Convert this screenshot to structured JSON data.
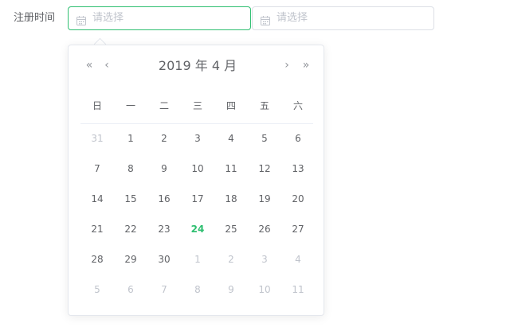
{
  "form": {
    "label": "注册时间",
    "start_placeholder": "请选择",
    "end_placeholder": "请选择"
  },
  "picker": {
    "year": "2019",
    "year_suffix": " 年 ",
    "month": "4",
    "month_suffix": " 月",
    "prev_year_glyph": "«",
    "prev_month_glyph": "‹",
    "next_month_glyph": "›",
    "next_year_glyph": "»",
    "weekdays": [
      "日",
      "一",
      "二",
      "三",
      "四",
      "五",
      "六"
    ],
    "weeks": [
      [
        {
          "d": "31",
          "t": "prev"
        },
        {
          "d": "1",
          "t": "cur"
        },
        {
          "d": "2",
          "t": "cur"
        },
        {
          "d": "3",
          "t": "cur"
        },
        {
          "d": "4",
          "t": "cur"
        },
        {
          "d": "5",
          "t": "cur"
        },
        {
          "d": "6",
          "t": "cur"
        }
      ],
      [
        {
          "d": "7",
          "t": "cur"
        },
        {
          "d": "8",
          "t": "cur"
        },
        {
          "d": "9",
          "t": "cur"
        },
        {
          "d": "10",
          "t": "cur"
        },
        {
          "d": "11",
          "t": "cur"
        },
        {
          "d": "12",
          "t": "cur"
        },
        {
          "d": "13",
          "t": "cur"
        }
      ],
      [
        {
          "d": "14",
          "t": "cur"
        },
        {
          "d": "15",
          "t": "cur"
        },
        {
          "d": "16",
          "t": "cur"
        },
        {
          "d": "17",
          "t": "cur"
        },
        {
          "d": "18",
          "t": "cur"
        },
        {
          "d": "19",
          "t": "cur"
        },
        {
          "d": "20",
          "t": "cur"
        }
      ],
      [
        {
          "d": "21",
          "t": "cur"
        },
        {
          "d": "22",
          "t": "cur"
        },
        {
          "d": "23",
          "t": "cur"
        },
        {
          "d": "24",
          "t": "today"
        },
        {
          "d": "25",
          "t": "cur"
        },
        {
          "d": "26",
          "t": "cur"
        },
        {
          "d": "27",
          "t": "cur"
        }
      ],
      [
        {
          "d": "28",
          "t": "cur"
        },
        {
          "d": "29",
          "t": "cur"
        },
        {
          "d": "30",
          "t": "cur"
        },
        {
          "d": "1",
          "t": "next"
        },
        {
          "d": "2",
          "t": "next"
        },
        {
          "d": "3",
          "t": "next"
        },
        {
          "d": "4",
          "t": "next"
        }
      ],
      [
        {
          "d": "5",
          "t": "next"
        },
        {
          "d": "6",
          "t": "next"
        },
        {
          "d": "7",
          "t": "next"
        },
        {
          "d": "8",
          "t": "next"
        },
        {
          "d": "9",
          "t": "next"
        },
        {
          "d": "10",
          "t": "next"
        },
        {
          "d": "11",
          "t": "next"
        }
      ]
    ]
  },
  "colors": {
    "accent": "#2fbf71",
    "text": "#606266",
    "muted": "#c0c4cc",
    "border": "#dcdfe6"
  },
  "icons": {
    "input_icon": "calendar-icon"
  }
}
